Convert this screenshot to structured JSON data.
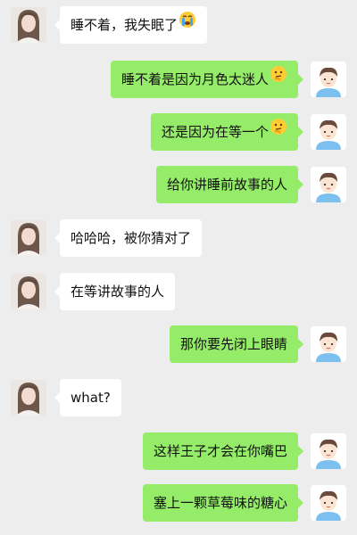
{
  "messages": [
    {
      "side": "left",
      "text": "睡不着，我失眠了",
      "emoji": "crying-face-icon"
    },
    {
      "side": "right",
      "text": "睡不着是因为月色太迷人",
      "emoji": "thinking-face-icon"
    },
    {
      "side": "right",
      "text": "还是因为在等一个",
      "emoji": "thinking-face-icon"
    },
    {
      "side": "right",
      "text": "给你讲睡前故事的人",
      "emoji": ""
    },
    {
      "side": "left",
      "text": "哈哈哈，被你猜对了",
      "emoji": ""
    },
    {
      "side": "left",
      "text": "在等讲故事的人",
      "emoji": ""
    },
    {
      "side": "right",
      "text": "那你要先闭上眼睛",
      "emoji": ""
    },
    {
      "side": "left",
      "text": "what?",
      "emoji": ""
    },
    {
      "side": "right",
      "text": "这样王子才会在你嘴巴",
      "emoji": ""
    },
    {
      "side": "right",
      "text": "塞上一颗草莓味的糖心",
      "emoji": ""
    }
  ],
  "colors": {
    "background": "#ededed",
    "outgoing_bubble": "#95ec69",
    "incoming_bubble": "#ffffff"
  },
  "avatars": {
    "left": "girl-avatar-icon",
    "right": "cartoon-boy-avatar-icon"
  }
}
